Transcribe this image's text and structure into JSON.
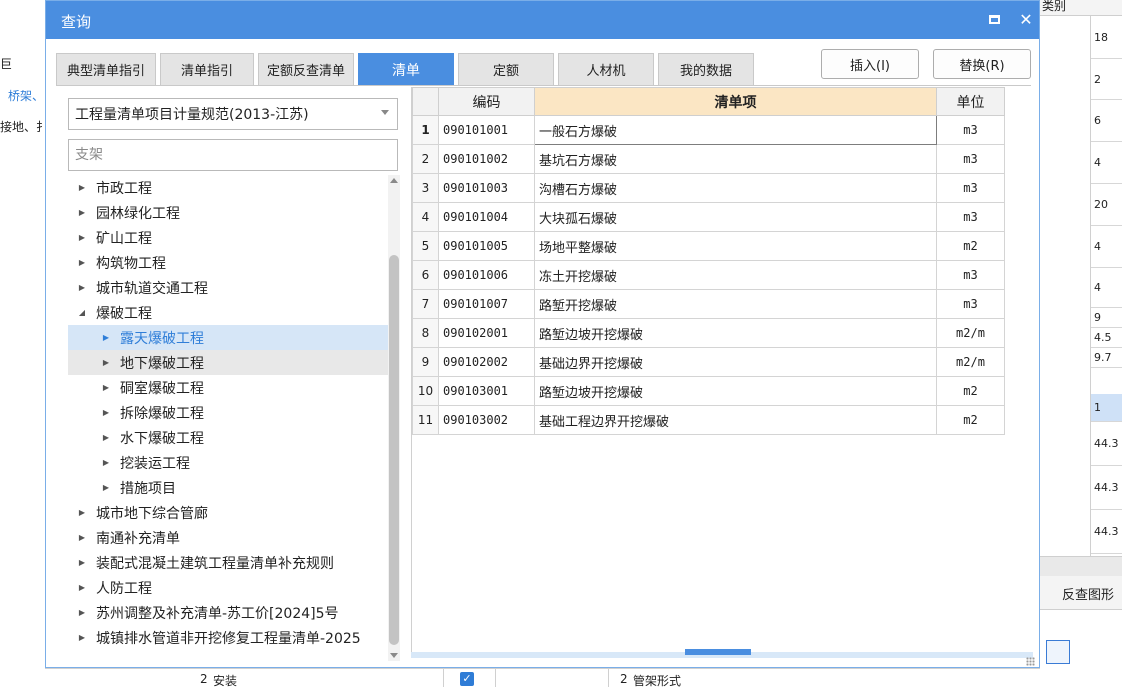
{
  "background": {
    "left_texts": [
      "巨",
      "桥架、",
      "接地、扌"
    ],
    "top_right_header": "类别",
    "right_values": [
      "18",
      "2",
      "6",
      "4",
      "20",
      "4",
      "4",
      "9",
      "4.5",
      "9.7",
      "1",
      "44.3",
      "44.3",
      "44.3"
    ],
    "right_pane_title": "反查图形",
    "bottom_row": {
      "index": "2",
      "name": "安装",
      "index2": "2",
      "name2": "管架形式",
      "checked": true
    }
  },
  "dialog": {
    "title": "查询",
    "tabs": [
      {
        "label": "典型清单指引"
      },
      {
        "label": "清单指引"
      },
      {
        "label": "定额反查清单"
      },
      {
        "label": "清单"
      },
      {
        "label": "定额"
      },
      {
        "label": "人材机"
      },
      {
        "label": "我的数据"
      }
    ],
    "active_tab": "清单",
    "buttons": {
      "insert": "插入(I)",
      "replace": "替换(R)"
    },
    "spec_select": "工程量清单项目计量规范(2013-江苏)",
    "search_placeholder": "支架",
    "tree": [
      {
        "label": "市政工程",
        "level": 0,
        "expanded": false
      },
      {
        "label": "园林绿化工程",
        "level": 0,
        "expanded": false
      },
      {
        "label": "矿山工程",
        "level": 0,
        "expanded": false
      },
      {
        "label": "构筑物工程",
        "level": 0,
        "expanded": false
      },
      {
        "label": "城市轨道交通工程",
        "level": 0,
        "expanded": false
      },
      {
        "label": "爆破工程",
        "level": 0,
        "expanded": true
      },
      {
        "label": "露天爆破工程",
        "level": 1,
        "expanded": false,
        "selected": true
      },
      {
        "label": "地下爆破工程",
        "level": 1,
        "expanded": false,
        "hover": true
      },
      {
        "label": "硐室爆破工程",
        "level": 1,
        "expanded": false
      },
      {
        "label": "拆除爆破工程",
        "level": 1,
        "expanded": false
      },
      {
        "label": "水下爆破工程",
        "level": 1,
        "expanded": false
      },
      {
        "label": "挖装运工程",
        "level": 1,
        "expanded": false
      },
      {
        "label": "措施项目",
        "level": 1,
        "expanded": false
      },
      {
        "label": "城市地下综合管廊",
        "level": 0,
        "expanded": false
      },
      {
        "label": "南通补充清单",
        "level": 0,
        "expanded": false
      },
      {
        "label": "装配式混凝土建筑工程量清单补充规则",
        "level": 0,
        "expanded": false
      },
      {
        "label": "人防工程",
        "level": 0,
        "expanded": false
      },
      {
        "label": "苏州调整及补充清单-苏工价[2024]5号",
        "level": 0,
        "expanded": false
      },
      {
        "label": "城镇排水管道非开挖修复工程量清单-2025",
        "level": 0,
        "expanded": false
      }
    ],
    "table": {
      "headers": {
        "code": "编码",
        "item": "清单项",
        "unit": "单位"
      },
      "rows": [
        {
          "num": "1",
          "code": "090101001",
          "item": "一般石方爆破",
          "unit": "m3"
        },
        {
          "num": "2",
          "code": "090101002",
          "item": "基坑石方爆破",
          "unit": "m3"
        },
        {
          "num": "3",
          "code": "090101003",
          "item": "沟槽石方爆破",
          "unit": "m3"
        },
        {
          "num": "4",
          "code": "090101004",
          "item": "大块孤石爆破",
          "unit": "m3"
        },
        {
          "num": "5",
          "code": "090101005",
          "item": "场地平整爆破",
          "unit": "m2"
        },
        {
          "num": "6",
          "code": "090101006",
          "item": "冻土开挖爆破",
          "unit": "m3"
        },
        {
          "num": "7",
          "code": "090101007",
          "item": "路堑开挖爆破",
          "unit": "m3"
        },
        {
          "num": "8",
          "code": "090102001",
          "item": "路堑边坡开挖爆破",
          "unit": "m2/m"
        },
        {
          "num": "9",
          "code": "090102002",
          "item": "基础边界开挖爆破",
          "unit": "m2/m"
        },
        {
          "num": "10",
          "code": "090103001",
          "item": "路堑边坡开挖爆破",
          "unit": "m2"
        },
        {
          "num": "11",
          "code": "090103002",
          "item": "基础工程边界开挖爆破",
          "unit": "m2"
        }
      ]
    }
  },
  "colors": {
    "accent": "#4a8ee0",
    "header_highlight": "#fbe6c4",
    "tree_selected": "#d6e6f7"
  }
}
